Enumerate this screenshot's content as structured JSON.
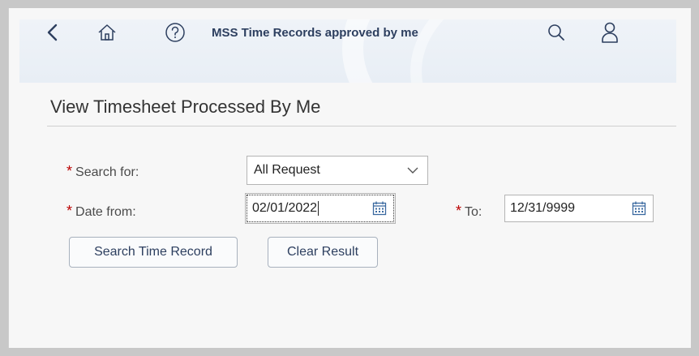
{
  "shellbar": {
    "title": "MSS Time Records approved by me",
    "icons": [
      "back-icon",
      "home-icon",
      "help-icon",
      "search-icon",
      "user-icon"
    ]
  },
  "page": {
    "title": "View Timesheet Processed By Me"
  },
  "form": {
    "required_marker": "*",
    "search_for_label": "Search for:",
    "search_for_value": "All Request",
    "date_from_label": "Date from:",
    "date_from_value": "02/01/2022",
    "to_label": "To:",
    "to_value": "12/31/9999"
  },
  "buttons": {
    "search_label": "Search Time Record",
    "clear_label": "Clear Result"
  },
  "colors": {
    "required": "#bb0000",
    "shellbar_text": "#2d3f5f",
    "calendar_icon": "#3b6aa0"
  }
}
